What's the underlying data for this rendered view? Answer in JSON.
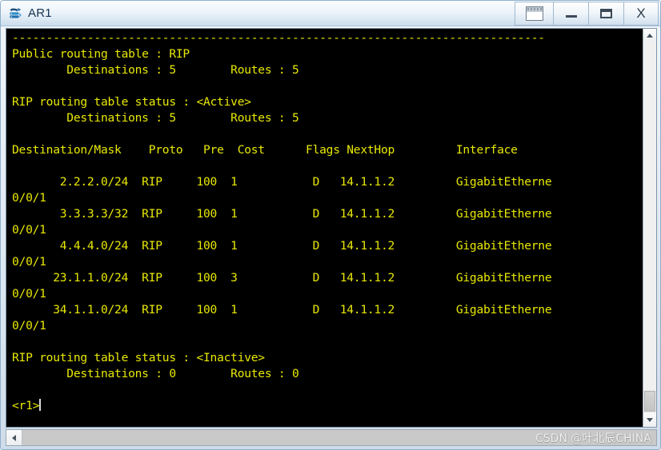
{
  "window": {
    "title": "AR1",
    "icon": "router-icon",
    "buttons": [
      {
        "name": "restore-panel-button",
        "icon": "panel-icon",
        "label": ""
      },
      {
        "name": "minimize-button",
        "icon": "minimize-icon",
        "label": ""
      },
      {
        "name": "maximize-button",
        "icon": "maximize-icon",
        "label": ""
      },
      {
        "name": "close-button",
        "icon": "close-icon",
        "label": "X"
      }
    ]
  },
  "terminal": {
    "lines": [
      "------------------------------------------------------------------------------",
      "Public routing table : RIP",
      "        Destinations : 5        Routes : 5",
      "",
      "RIP routing table status : <Active>",
      "        Destinations : 5        Routes : 5",
      "",
      "Destination/Mask    Proto   Pre  Cost      Flags NextHop         Interface",
      "",
      "       2.2.2.0/24  RIP     100  1           D   14.1.1.2         GigabitEtherne",
      "0/0/1",
      "       3.3.3.3/32  RIP     100  1           D   14.1.1.2         GigabitEtherne",
      "0/0/1",
      "       4.4.4.0/24  RIP     100  1           D   14.1.1.2         GigabitEtherne",
      "0/0/1",
      "      23.1.1.0/24  RIP     100  3           D   14.1.1.2         GigabitEtherne",
      "0/0/1",
      "      34.1.1.0/24  RIP     100  1           D   14.1.1.2         GigabitEtherne",
      "0/0/1",
      "",
      "RIP routing table status : <Inactive>",
      "        Destinations : 0        Routes : 0",
      "",
      "<r1>"
    ],
    "prompt": "<r1>",
    "fg_color": "#e8e800",
    "bg_color": "#000000",
    "cursor_color": "#d8d8d8"
  },
  "routing_table": {
    "public_table_label": "Public routing table : RIP",
    "summary": {
      "destinations_label": "Destinations",
      "destinations": "5",
      "routes_label": "Routes",
      "routes": "5"
    },
    "active_status_label": "RIP routing table status : <Active>",
    "active_summary": {
      "destinations": "5",
      "routes": "5"
    },
    "inactive_status_label": "RIP routing table status : <Inactive>",
    "inactive_summary": {
      "destinations": "0",
      "routes": "0"
    },
    "columns": [
      "Destination/Mask",
      "Proto",
      "Pre",
      "Cost",
      "Flags",
      "NextHop",
      "Interface"
    ],
    "rows": [
      {
        "destination": "2.2.2.0/24",
        "proto": "RIP",
        "pre": "100",
        "cost": "1",
        "flags": "D",
        "nexthop": "14.1.1.2",
        "interface": "GigabitEtherne",
        "interface_wrap": "0/0/1"
      },
      {
        "destination": "3.3.3.3/32",
        "proto": "RIP",
        "pre": "100",
        "cost": "1",
        "flags": "D",
        "nexthop": "14.1.1.2",
        "interface": "GigabitEtherne",
        "interface_wrap": "0/0/1"
      },
      {
        "destination": "4.4.4.0/24",
        "proto": "RIP",
        "pre": "100",
        "cost": "1",
        "flags": "D",
        "nexthop": "14.1.1.2",
        "interface": "GigabitEtherne",
        "interface_wrap": "0/0/1"
      },
      {
        "destination": "23.1.1.0/24",
        "proto": "RIP",
        "pre": "100",
        "cost": "3",
        "flags": "D",
        "nexthop": "14.1.1.2",
        "interface": "GigabitEtherne",
        "interface_wrap": "0/0/1"
      },
      {
        "destination": "34.1.1.0/24",
        "proto": "RIP",
        "pre": "100",
        "cost": "1",
        "flags": "D",
        "nexthop": "14.1.1.2",
        "interface": "GigabitEtherne",
        "interface_wrap": "0/0/1"
      }
    ]
  },
  "scrollbars": {
    "vertical": {
      "up_icon": "chevron-up-icon",
      "down_icon": "chevron-down-icon"
    },
    "horizontal": {
      "left_icon": "chevron-left-icon"
    }
  },
  "watermark": "CSDN @叶北辰CHINA"
}
